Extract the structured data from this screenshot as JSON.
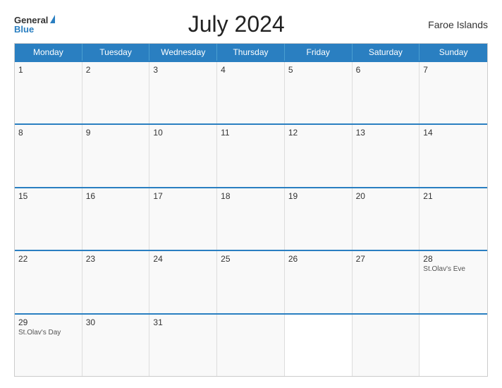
{
  "header": {
    "logo_general": "General",
    "logo_blue": "Blue",
    "title": "July 2024",
    "region": "Faroe Islands"
  },
  "days": [
    "Monday",
    "Tuesday",
    "Wednesday",
    "Thursday",
    "Friday",
    "Saturday",
    "Sunday"
  ],
  "weeks": [
    [
      {
        "num": "1",
        "event": ""
      },
      {
        "num": "2",
        "event": ""
      },
      {
        "num": "3",
        "event": ""
      },
      {
        "num": "4",
        "event": ""
      },
      {
        "num": "5",
        "event": ""
      },
      {
        "num": "6",
        "event": ""
      },
      {
        "num": "7",
        "event": ""
      }
    ],
    [
      {
        "num": "8",
        "event": ""
      },
      {
        "num": "9",
        "event": ""
      },
      {
        "num": "10",
        "event": ""
      },
      {
        "num": "11",
        "event": ""
      },
      {
        "num": "12",
        "event": ""
      },
      {
        "num": "13",
        "event": ""
      },
      {
        "num": "14",
        "event": ""
      }
    ],
    [
      {
        "num": "15",
        "event": ""
      },
      {
        "num": "16",
        "event": ""
      },
      {
        "num": "17",
        "event": ""
      },
      {
        "num": "18",
        "event": ""
      },
      {
        "num": "19",
        "event": ""
      },
      {
        "num": "20",
        "event": ""
      },
      {
        "num": "21",
        "event": ""
      }
    ],
    [
      {
        "num": "22",
        "event": ""
      },
      {
        "num": "23",
        "event": ""
      },
      {
        "num": "24",
        "event": ""
      },
      {
        "num": "25",
        "event": ""
      },
      {
        "num": "26",
        "event": ""
      },
      {
        "num": "27",
        "event": ""
      },
      {
        "num": "28",
        "event": "St.Olav's Eve"
      }
    ],
    [
      {
        "num": "29",
        "event": "St.Olav's Day"
      },
      {
        "num": "30",
        "event": ""
      },
      {
        "num": "31",
        "event": ""
      },
      {
        "num": "",
        "event": ""
      },
      {
        "num": "",
        "event": ""
      },
      {
        "num": "",
        "event": ""
      },
      {
        "num": "",
        "event": ""
      }
    ]
  ]
}
